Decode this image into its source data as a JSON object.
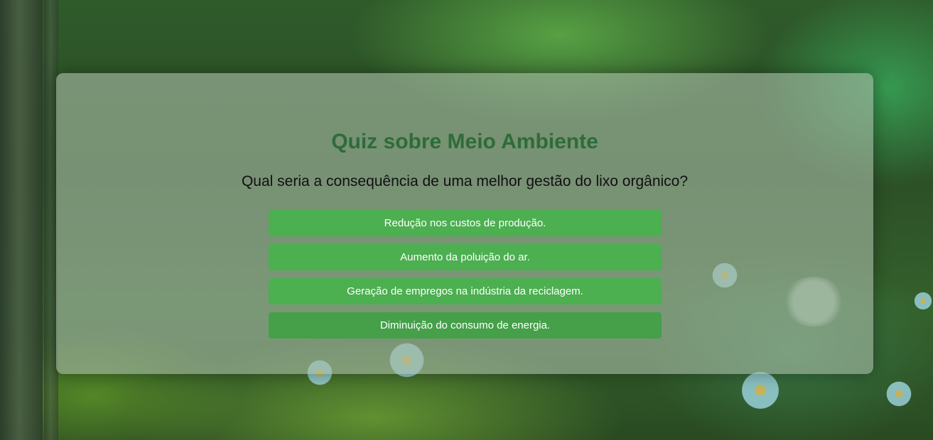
{
  "quiz": {
    "title": "Quiz sobre Meio Ambiente",
    "question": "Qual seria a consequência de uma melhor gestão do lixo orgânico?",
    "answers": [
      "Redução nos custos de produção.",
      "Aumento da poluição do ar.",
      "Geração de empregos na indústria da reciclagem.",
      "Diminuição do consumo de energia."
    ]
  },
  "colors": {
    "title": "#2f6b3a",
    "button": "#4caf50",
    "button_hover": "#45a049",
    "button_text": "#ffffff"
  }
}
